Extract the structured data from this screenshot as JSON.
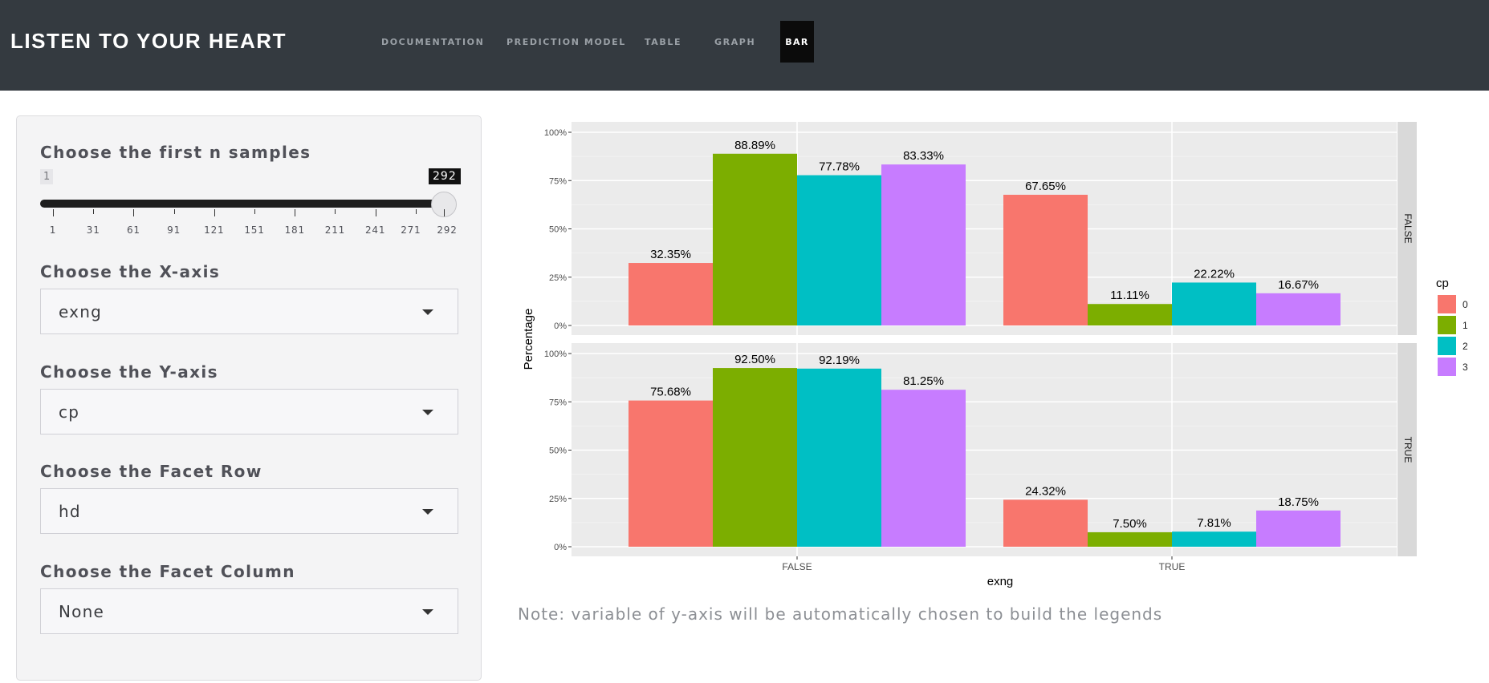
{
  "app": {
    "title": "LISTEN TO YOUR HEART"
  },
  "nav": {
    "items": [
      {
        "label": "DOCUMENTATION"
      },
      {
        "label": "PREDICTION MODEL"
      },
      {
        "label": "TABLE"
      },
      {
        "label": "GRAPH"
      },
      {
        "label": "BAR",
        "active": true
      }
    ]
  },
  "sidebar": {
    "slider": {
      "label": "Choose the first n samples",
      "min_label": "1",
      "value_label": "292",
      "min": 1,
      "max": 292,
      "value": 292,
      "ticks": [
        "1",
        "31",
        "61",
        "91",
        "121",
        "151",
        "181",
        "211",
        "241",
        "271",
        "292"
      ]
    },
    "x_axis": {
      "label": "Choose the X-axis",
      "value": "exng"
    },
    "y_axis": {
      "label": "Choose the Y-axis",
      "value": "cp"
    },
    "facet_row": {
      "label": "Choose the Facet Row",
      "value": "hd"
    },
    "facet_col": {
      "label": "Choose the Facet Column",
      "value": "None"
    }
  },
  "note": "Note: variable of y-axis will be automatically chosen to build the legends",
  "chart_data": {
    "type": "bar",
    "xlabel": "exng",
    "ylabel": "Percentage",
    "ylim": [
      0,
      100
    ],
    "y_ticks": [
      "0%",
      "25%",
      "50%",
      "75%",
      "100%"
    ],
    "categories": [
      "FALSE",
      "TRUE"
    ],
    "legend": {
      "title": "cp",
      "position": "right",
      "entries": [
        "0",
        "1",
        "2",
        "3"
      ]
    },
    "colors": {
      "0": "#f8766d",
      "1": "#7cae00",
      "2": "#00bfc4",
      "3": "#c77cff"
    },
    "panel_background": "#ebebeb",
    "strip_background": "#d9d9d9",
    "facets": [
      {
        "row": "FALSE",
        "series": [
          {
            "name": "0",
            "values": [
              32.35,
              67.65
            ],
            "labels": [
              "32.35%",
              "67.65%"
            ]
          },
          {
            "name": "1",
            "values": [
              88.89,
              11.11
            ],
            "labels": [
              "88.89%",
              "11.11%"
            ]
          },
          {
            "name": "2",
            "values": [
              77.78,
              22.22
            ],
            "labels": [
              "77.78%",
              "22.22%"
            ]
          },
          {
            "name": "3",
            "values": [
              83.33,
              16.67
            ],
            "labels": [
              "83.33%",
              "16.67%"
            ]
          }
        ]
      },
      {
        "row": "TRUE",
        "series": [
          {
            "name": "0",
            "values": [
              75.68,
              24.32
            ],
            "labels": [
              "75.68%",
              "24.32%"
            ]
          },
          {
            "name": "1",
            "values": [
              92.5,
              7.5
            ],
            "labels": [
              "92.50%",
              "7.50%"
            ]
          },
          {
            "name": "2",
            "values": [
              92.19,
              7.81
            ],
            "labels": [
              "92.19%",
              "7.81%"
            ]
          },
          {
            "name": "3",
            "values": [
              81.25,
              18.75
            ],
            "labels": [
              "81.25%",
              "18.75%"
            ]
          }
        ]
      }
    ]
  }
}
